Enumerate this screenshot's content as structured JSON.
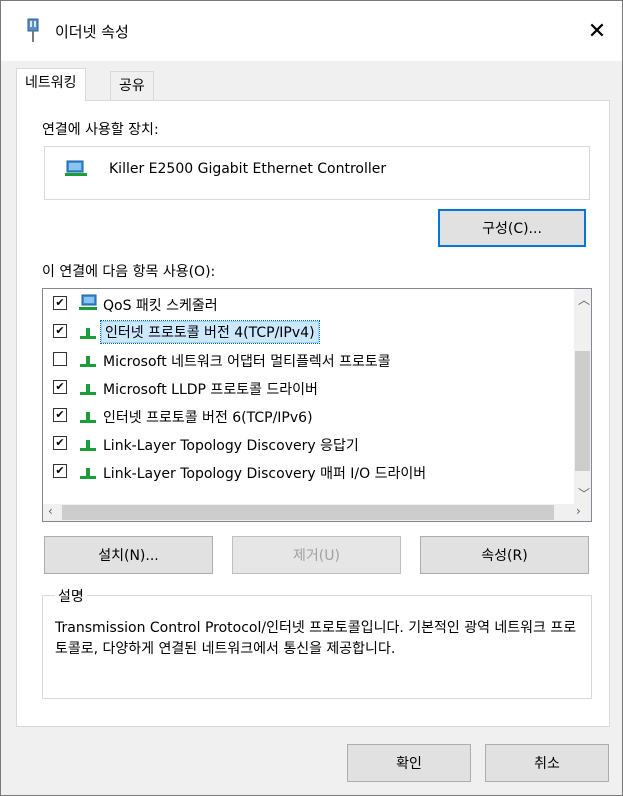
{
  "window": {
    "title": "이더넷 속성",
    "close_label": "✕"
  },
  "tabs": [
    {
      "label": "네트워킹",
      "active": true
    },
    {
      "label": "공유",
      "active": false
    }
  ],
  "connect_using": {
    "label": "연결에 사용할 장치:",
    "device_name": "Killer E2500 Gigabit Ethernet Controller",
    "configure_label": "구성(C)..."
  },
  "items": {
    "label": "이 연결에 다음 항목 사용(O):",
    "list": [
      {
        "text": "QoS 패킷 스케줄러",
        "checked": true,
        "icon": "qos-network-icon"
      },
      {
        "text": "인터넷 프로토콜 버전 4(TCP/IPv4)",
        "checked": true,
        "icon": "protocol-icon",
        "selected": true
      },
      {
        "text": "Microsoft 네트워크 어댑터 멀티플렉서 프로토콜",
        "checked": false,
        "icon": "protocol-icon"
      },
      {
        "text": "Microsoft LLDP 프로토콜 드라이버",
        "checked": true,
        "icon": "protocol-icon"
      },
      {
        "text": "인터넷 프로토콜 버전 6(TCP/IPv6)",
        "checked": true,
        "icon": "protocol-icon"
      },
      {
        "text": "Link-Layer Topology Discovery 응답기",
        "checked": true,
        "icon": "protocol-icon"
      },
      {
        "text": "Link-Layer Topology Discovery 매퍼 I/O 드라이버",
        "checked": true,
        "icon": "protocol-icon"
      }
    ]
  },
  "buttons": {
    "install": "설치(N)...",
    "uninstall": "제거(U)",
    "properties": "속성(R)",
    "ok": "확인",
    "cancel": "취소"
  },
  "description": {
    "title": "설명",
    "text": "Transmission Control Protocol/인터넷 프로토콜입니다. 기본적인 광역 네트워크 프로토콜로, 다양하게 연결된 네트워크에서 통신을 제공합니다."
  },
  "colors": {
    "accent": "#0078d7",
    "selection": "#cce8ff",
    "icon_green": "#1a9e3a",
    "icon_blue": "#3a8fd6"
  }
}
